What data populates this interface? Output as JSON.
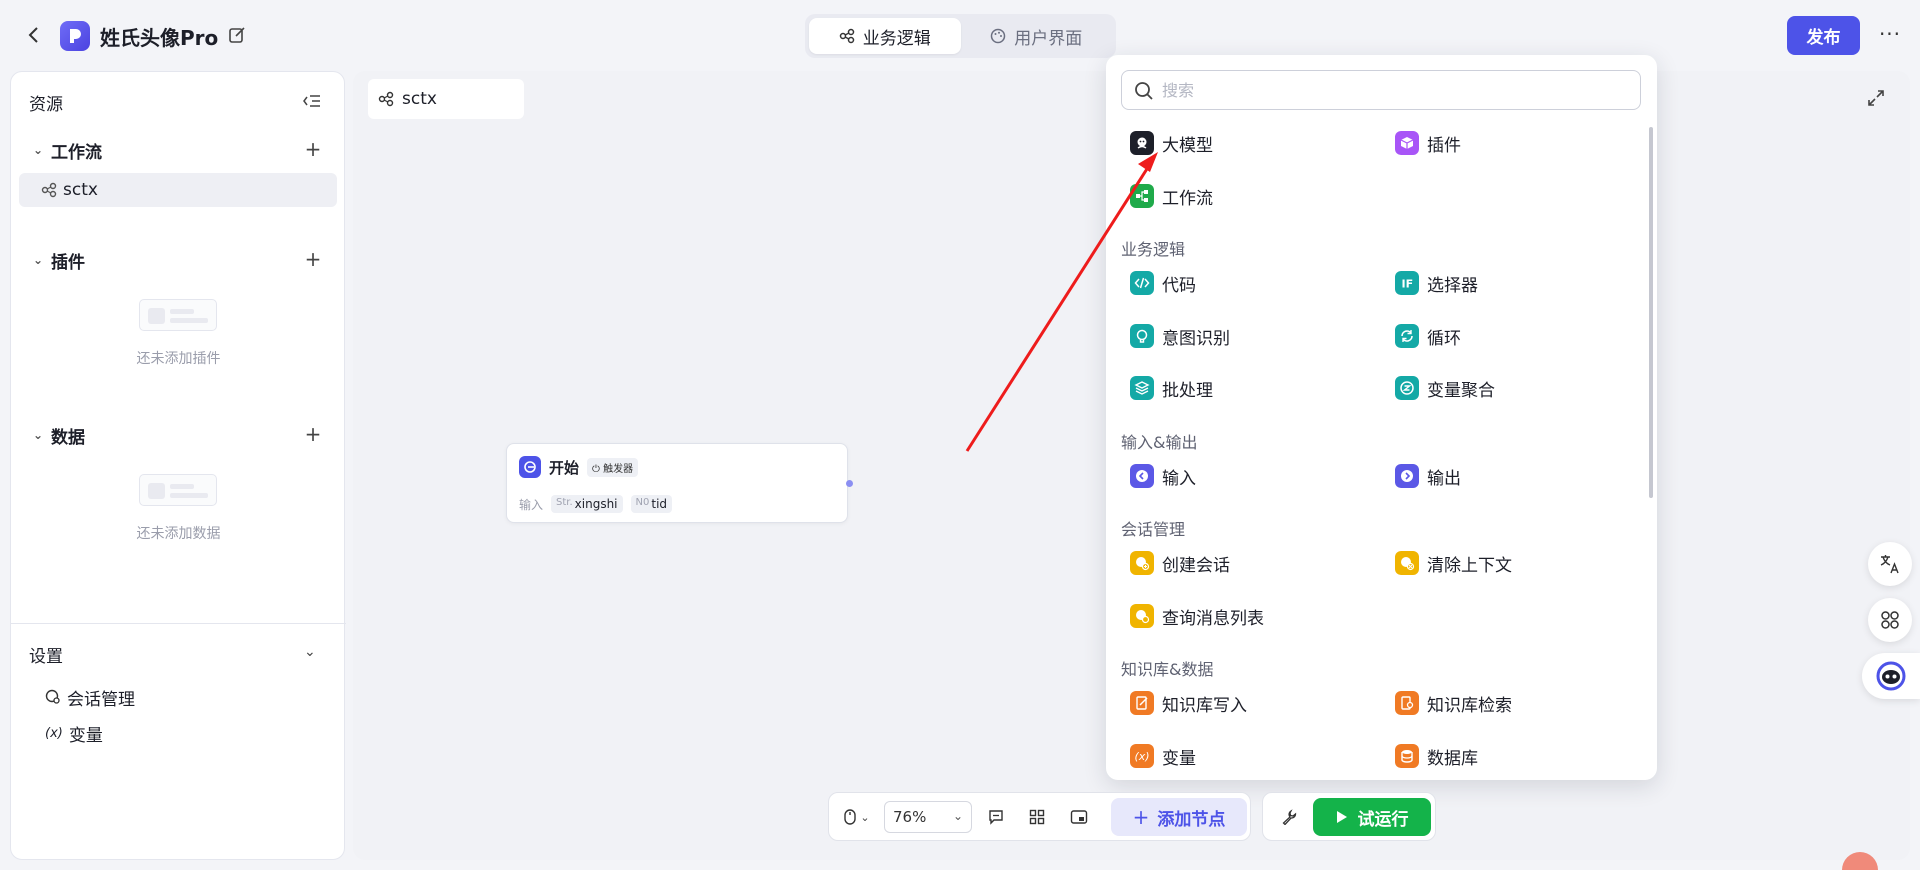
{
  "header": {
    "app_title": "姓氏头像Pro",
    "tabs": [
      {
        "label": "业务逻辑",
        "active": true
      },
      {
        "label": "用户界面",
        "active": false
      }
    ],
    "publish_label": "发布",
    "more_label": "···"
  },
  "sidebar": {
    "title": "资源",
    "workflow": {
      "label": "工作流",
      "items": [
        "sctx"
      ]
    },
    "plugins": {
      "label": "插件",
      "empty_text": "还未添加插件"
    },
    "data": {
      "label": "数据",
      "empty_text": "还未添加数据"
    },
    "settings": {
      "label": "设置",
      "items": [
        {
          "label": "会话管理",
          "icon": "chat-gear-icon"
        },
        {
          "label": "变量",
          "icon": "variable-icon",
          "prefix": "(x)"
        }
      ]
    }
  },
  "canvas": {
    "tab_label": "sctx",
    "start_node": {
      "title": "开始",
      "trigger_label": "触发器",
      "inputs_label": "输入",
      "inputs": [
        {
          "type": "Str.",
          "name": "xingshi"
        },
        {
          "type": "N0",
          "name": "tid"
        }
      ]
    }
  },
  "popup": {
    "search_placeholder": "搜索",
    "top_items": [
      {
        "label": "大模型",
        "color": "#1d1f29"
      },
      {
        "label": "插件",
        "color": "#a855f7"
      },
      {
        "label": "工作流",
        "color": "#1faa4a"
      }
    ],
    "categories": [
      {
        "label": "业务逻辑",
        "items": [
          {
            "label": "代码",
            "color": "#14a9a6"
          },
          {
            "label": "选择器",
            "color": "#14a9a6"
          },
          {
            "label": "意图识别",
            "color": "#14a9a6"
          },
          {
            "label": "循环",
            "color": "#14a9a6"
          },
          {
            "label": "批处理",
            "color": "#14a9a6"
          },
          {
            "label": "变量聚合",
            "color": "#14a9a6"
          }
        ]
      },
      {
        "label": "输入&输出",
        "items": [
          {
            "label": "输入",
            "color": "#5b58e6"
          },
          {
            "label": "输出",
            "color": "#5b58e6"
          }
        ]
      },
      {
        "label": "会话管理",
        "items": [
          {
            "label": "创建会话",
            "color": "#f0b400"
          },
          {
            "label": "清除上下文",
            "color": "#f0b400"
          },
          {
            "label": "查询消息列表",
            "color": "#f0b400"
          }
        ]
      },
      {
        "label": "知识库&数据",
        "items": [
          {
            "label": "知识库写入",
            "color": "#f07a24"
          },
          {
            "label": "知识库检索",
            "color": "#f07a24"
          },
          {
            "label": "变量",
            "color": "#f07a24",
            "glyph": "(x)"
          },
          {
            "label": "数据库",
            "color": "#f07a24"
          }
        ]
      }
    ]
  },
  "toolbar": {
    "zoom": "76%",
    "add_node_label": "添加节点",
    "run_label": "试运行"
  },
  "colors": {
    "accent": "#4d53e8",
    "run_green": "#14b34a",
    "annotation_arrow": "#ee1c1c"
  }
}
